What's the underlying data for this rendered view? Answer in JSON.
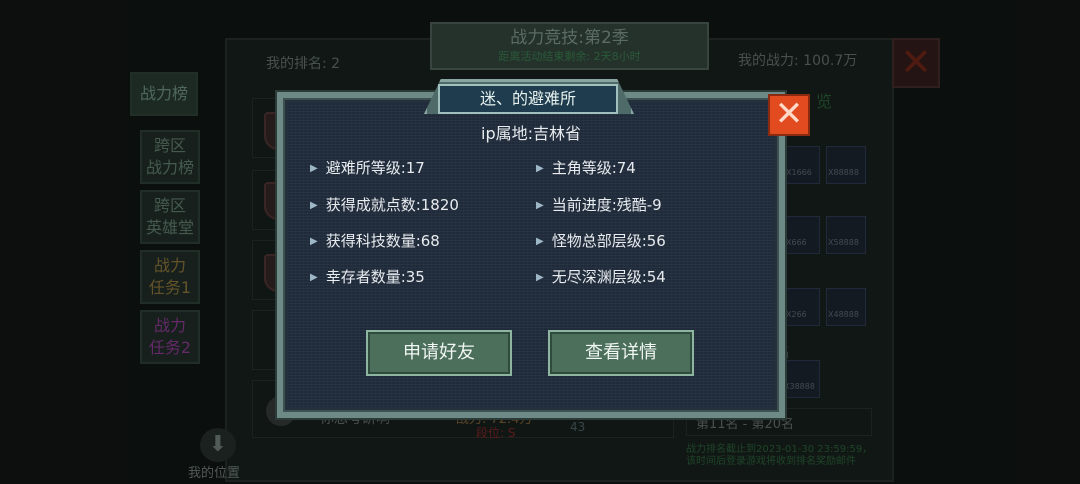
{
  "background": {
    "season_title": "战力竞技:第2季",
    "countdown": "距离活动结束剩余: 2天8小时",
    "my_rank": "我的排名: 2",
    "my_power": "我的战力: 100.7万",
    "side_tabs": [
      {
        "label": "战力榜"
      },
      {
        "label": "跨区\n战力榜"
      },
      {
        "label": "跨区\n英雄堂"
      },
      {
        "label": "战力\n任务1"
      },
      {
        "label": "战力\n任务2"
      }
    ],
    "right_header": "览",
    "reward_counts": [
      "X1666",
      "X88888",
      "X666",
      "X58888",
      "X266",
      "X48888",
      "X38888"
    ],
    "rank_fragment": "名",
    "bottom_row": {
      "rank": "5",
      "name": "你想考研啊",
      "power": "战力: 72.4万",
      "position": "段位: S",
      "count": "43"
    },
    "range_label": "第11名 - 第20名",
    "notice": "战力排名截止到2023-01-30 23:59:59，该时间后登录游戏将收到排名奖励邮件",
    "my_position": "我的位置"
  },
  "modal": {
    "title": "迷、的避难所",
    "ip": "ip属地:吉林省",
    "stats_left": [
      {
        "label": "避难所等级:17"
      },
      {
        "label": "获得成就点数:1820"
      },
      {
        "label": "获得科技数量:68"
      },
      {
        "label": "幸存者数量:35"
      }
    ],
    "stats_right": [
      {
        "label": "主角等级:74"
      },
      {
        "label": "当前进度:残酷-9"
      },
      {
        "label": "怪物总部层级:56"
      },
      {
        "label": "无尽深渊层级:54"
      }
    ],
    "add_friend": "申请好友",
    "view_details": "查看详情",
    "close": "✕"
  },
  "icons": {
    "stat_arrow": "▶",
    "close_x": "✕",
    "down_arrow": "⬇"
  }
}
